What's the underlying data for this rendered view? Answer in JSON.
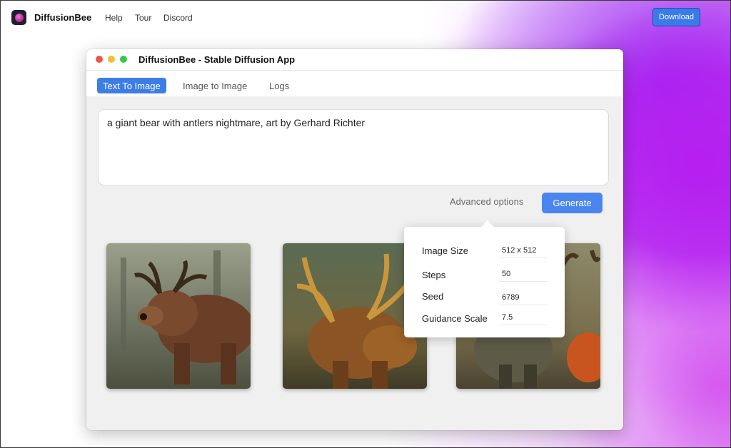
{
  "nav": {
    "brand": "DiffusionBee",
    "links": [
      "Help",
      "Tour",
      "Discord"
    ],
    "download_label": "Download"
  },
  "window": {
    "title": "DiffusionBee - Stable Diffusion App",
    "tabs": [
      {
        "label": "Text To Image",
        "active": true
      },
      {
        "label": "Image to Image",
        "active": false
      },
      {
        "label": "Logs",
        "active": false
      }
    ],
    "prompt": "a giant bear with antlers nightmare, art by Gerhard Richter",
    "advanced_options_label": "Advanced options",
    "generate_label": "Generate",
    "advanced_options": [
      {
        "label": "Image Size",
        "value": "512 x 512"
      },
      {
        "label": "Steps",
        "value": "50"
      },
      {
        "label": "Seed",
        "value": "6789"
      },
      {
        "label": "Guidance Scale",
        "value": "7.5"
      }
    ]
  },
  "colors": {
    "accent": "#3c7ee6",
    "download_button": "#3b7be8",
    "gradient_purple": "#b51ff0"
  },
  "icons": [
    "diffusionbee-logo-icon"
  ]
}
